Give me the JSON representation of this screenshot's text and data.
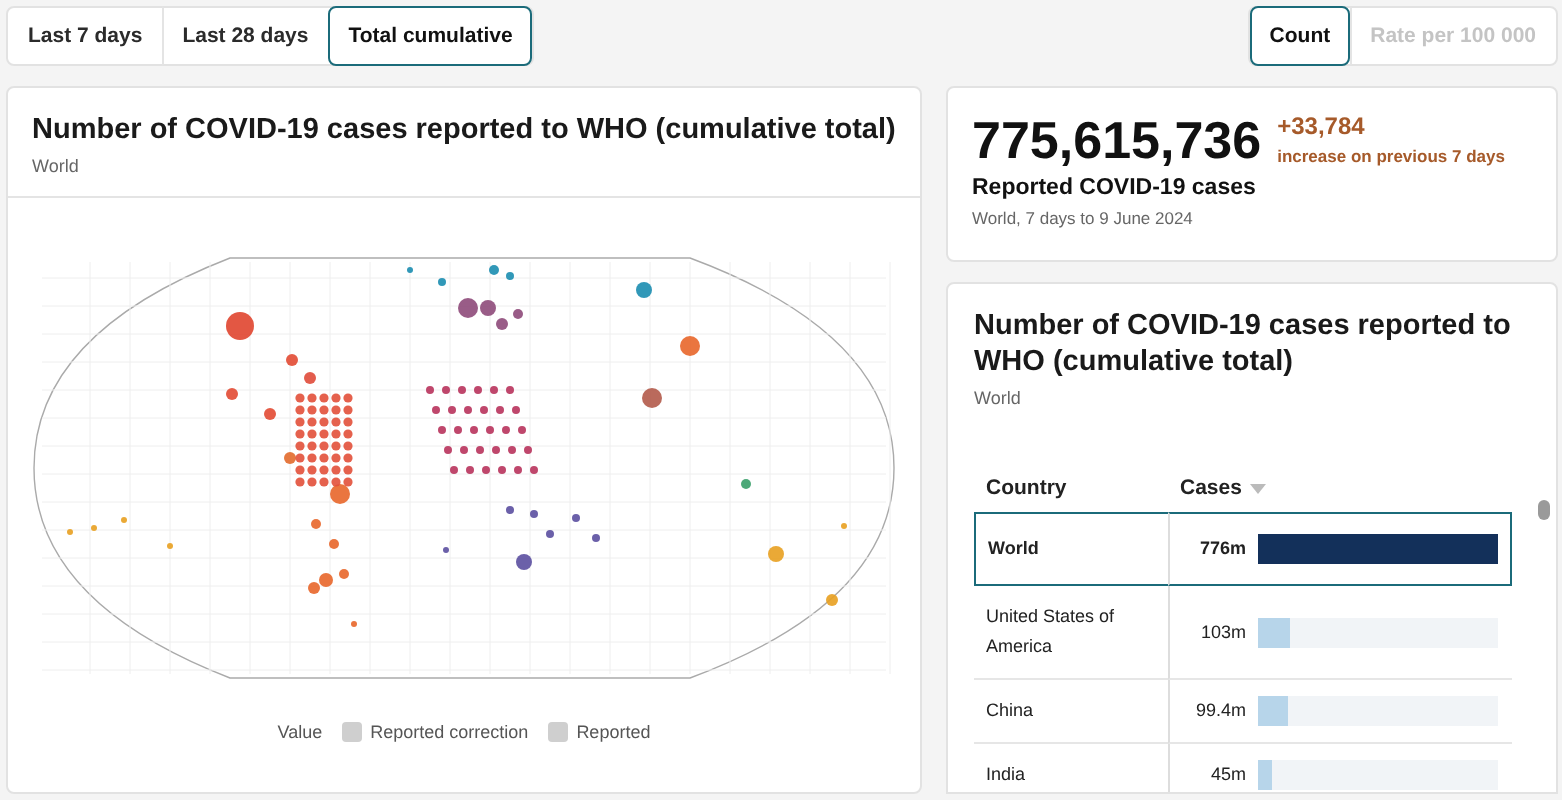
{
  "period_tabs": [
    {
      "label": "Last 7 days",
      "selected": false
    },
    {
      "label": "Last 28 days",
      "selected": false
    },
    {
      "label": "Total cumulative",
      "selected": true
    }
  ],
  "measure_toggle": [
    {
      "label": "Count",
      "selected": true
    },
    {
      "label": "Rate per 100 000",
      "selected": false
    }
  ],
  "map_card": {
    "title": "Number of COVID-19 cases reported to WHO (cumulative total)",
    "subtitle": "World",
    "legend": {
      "title": "Value",
      "items": [
        "Reported correction",
        "Reported"
      ]
    }
  },
  "summary_card": {
    "total": "775,615,736",
    "change": "+33,784",
    "change_note": "increase on previous 7 days",
    "label": "Reported COVID-19 cases",
    "note": "World, 7 days to 9 June 2024"
  },
  "table_card": {
    "title": "Number of COVID-19 cases reported to WHO (cumulative total)",
    "subtitle": "World",
    "columns": [
      "Country",
      "Cases"
    ],
    "rows": [
      {
        "country": "World",
        "cases": "776m",
        "level": 1.0,
        "selected": true
      },
      {
        "country": "United States of America",
        "cases": "103m",
        "level": 0.133,
        "selected": false
      },
      {
        "country": "China",
        "cases": "99.4m",
        "level": 0.128,
        "selected": false
      },
      {
        "country": "India",
        "cases": "45m",
        "level": 0.058,
        "selected": false
      }
    ]
  }
}
